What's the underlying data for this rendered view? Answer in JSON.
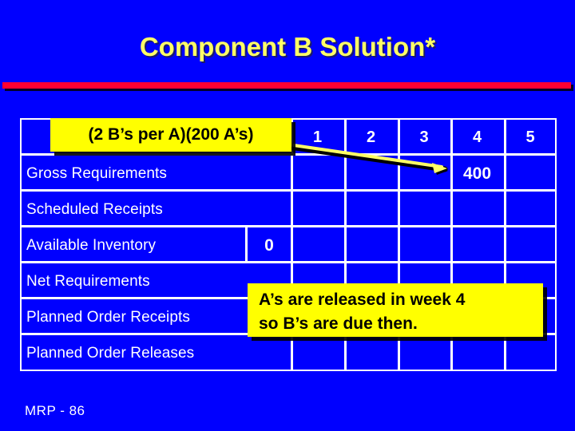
{
  "slide": {
    "title": "Component B Solution*",
    "footer": "MRP - 86",
    "accent_color": "#ff0033",
    "background_color": "#0000ff",
    "title_color": "#ffff66"
  },
  "table": {
    "period_headers": [
      "1",
      "2",
      "3",
      "4",
      "5"
    ],
    "rows": [
      {
        "label": "Gross Requirements",
        "inventory": "",
        "values": [
          "",
          "",
          "",
          "400",
          ""
        ]
      },
      {
        "label": "Scheduled Receipts",
        "inventory": "",
        "values": [
          "",
          "",
          "",
          "",
          ""
        ]
      },
      {
        "label": "Available Inventory",
        "inventory": "0",
        "values": [
          "",
          "",
          "",
          "",
          ""
        ]
      },
      {
        "label": "Net Requirements",
        "inventory": "",
        "values": [
          "",
          "",
          "",
          "",
          ""
        ]
      },
      {
        "label": "Planned Order Receipts",
        "inventory": "",
        "values": [
          "",
          "",
          "",
          "",
          ""
        ]
      },
      {
        "label": "Planned Order Releases",
        "inventory": "",
        "values": [
          "",
          "",
          "",
          "",
          ""
        ]
      }
    ]
  },
  "callouts": {
    "ratio": "(2 B’s per A)(200 A’s)",
    "note_line1": "A’s are released in week 4",
    "note_line2": "so B’s are due then.",
    "color": "#ffff00"
  }
}
